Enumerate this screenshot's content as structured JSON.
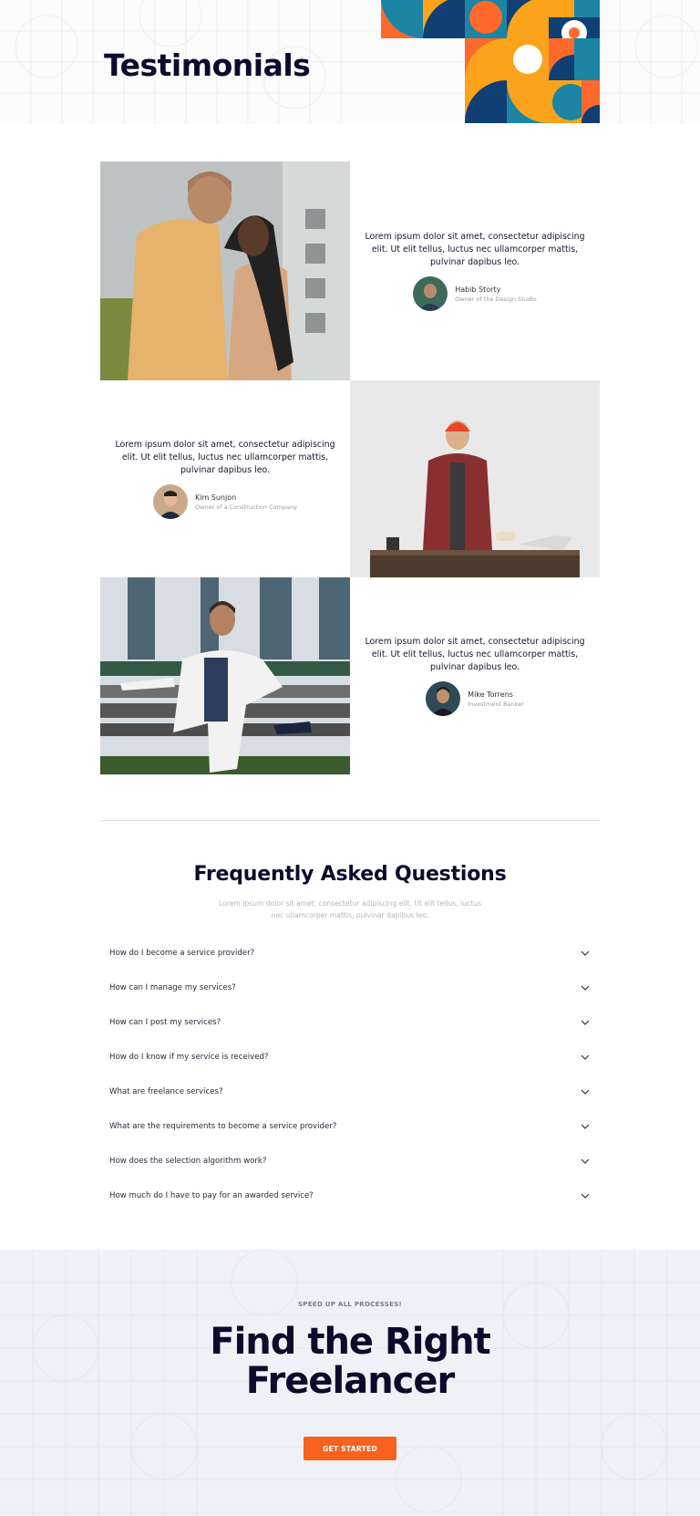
{
  "hero": {
    "title": "Testimonials",
    "art_colors": [
      "#fca31b",
      "#ff6a2c",
      "#0f3f73",
      "#1b85a3",
      "#ffffff"
    ]
  },
  "testimonials": [
    {
      "quote": "Lorem ipsum dolor sit amet, consectetur adipiscing elit. Ut elit tellus, luctus nec ullamcorper mattis, pulvinar dapibus leo.",
      "name": "Habib Storty",
      "role": "Owner of the Design Studio",
      "photo": "couple-photo"
    },
    {
      "quote": "Lorem ipsum dolor sit amet, consectetur adipiscing elit. Ut elit tellus, luctus nec ullamcorper mattis, pulvinar dapibus leo.",
      "name": "Kim Sunjon",
      "role": "Owner of a Construction Company",
      "photo": "builder-photo"
    },
    {
      "quote": "Lorem ipsum dolor sit amet, consectetur adipiscing elit. Ut elit tellus, luctus nec ullamcorper mattis, pulvinar dapibus leo.",
      "name": "Mike Torrens",
      "role": "Investment Banker",
      "photo": "banker-photo"
    }
  ],
  "faq": {
    "title": "Frequently Asked Questions",
    "subtitle": "Lorem ipsum dolor sit amet, consectetur adipiscing elit. Ut elit tellus, luctus nec ullamcorper mattis, pulvinar dapibus leo.",
    "items": [
      "How do I become a service provider?",
      "How can I manage my services?",
      "How can I post my services?",
      "How do I know if my service is received?",
      "What are freelance services?",
      "What are the requirements to become a service provider?",
      "How does the selection algorithm work?",
      "How much do I have to pay for an awarded service?"
    ]
  },
  "cta": {
    "kicker": "SPEED UP ALL PROCESSES!",
    "title_line1": "Find the Right",
    "title_line2": "Freelancer",
    "button_label": "GET STARTED",
    "button_color": "#f7621f"
  }
}
